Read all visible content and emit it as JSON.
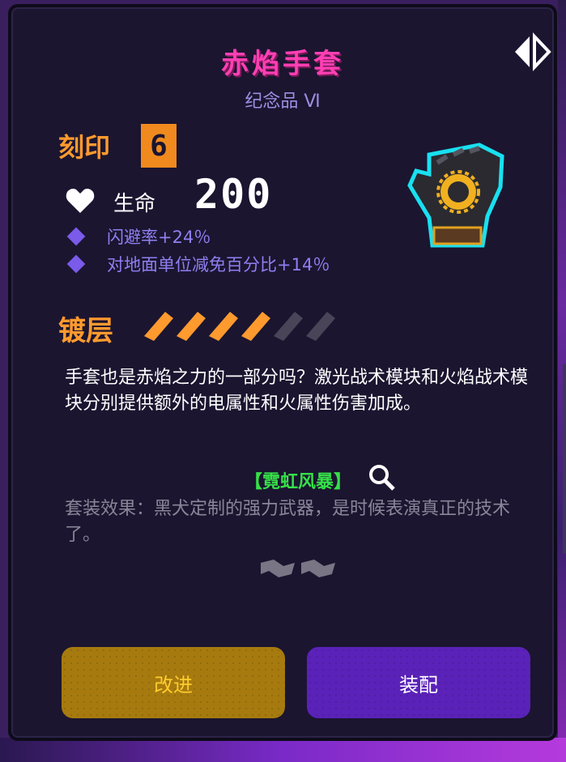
{
  "item": {
    "name": "赤焰手套",
    "category": "纪念品 Ⅵ"
  },
  "engrave": {
    "label": "刻印",
    "level": "6"
  },
  "health": {
    "label": "生命",
    "value": "200"
  },
  "stats": [
    {
      "text": "闪避率+24％"
    },
    {
      "text": "对地面单位减免百分比+14％"
    }
  ],
  "plating": {
    "label": "镀层",
    "filled": 4,
    "total": 6
  },
  "description": "手套也是赤焰之力的一部分吗？激光战术模块和火焰战术模块分别提供额外的电属性和火属性伤害加成。",
  "set": {
    "name": "【霓虹风暴】",
    "effect": "套装效果：黑犬定制的强力武器，是时候表演真正的技术了。"
  },
  "buttons": {
    "upgrade": "改进",
    "equip": "装配"
  },
  "colors": {
    "title": "#ff3fb4",
    "accent_orange": "#ff9a2e",
    "stat_purple": "#8f7ff0",
    "set_green": "#35e048",
    "upgrade_button": "#a67a0e",
    "equip_button": "#5a22b8"
  },
  "icons": {
    "swap": "swap-icon",
    "heart": "heart-icon",
    "glove": "glove-icon",
    "search": "search-icon"
  }
}
